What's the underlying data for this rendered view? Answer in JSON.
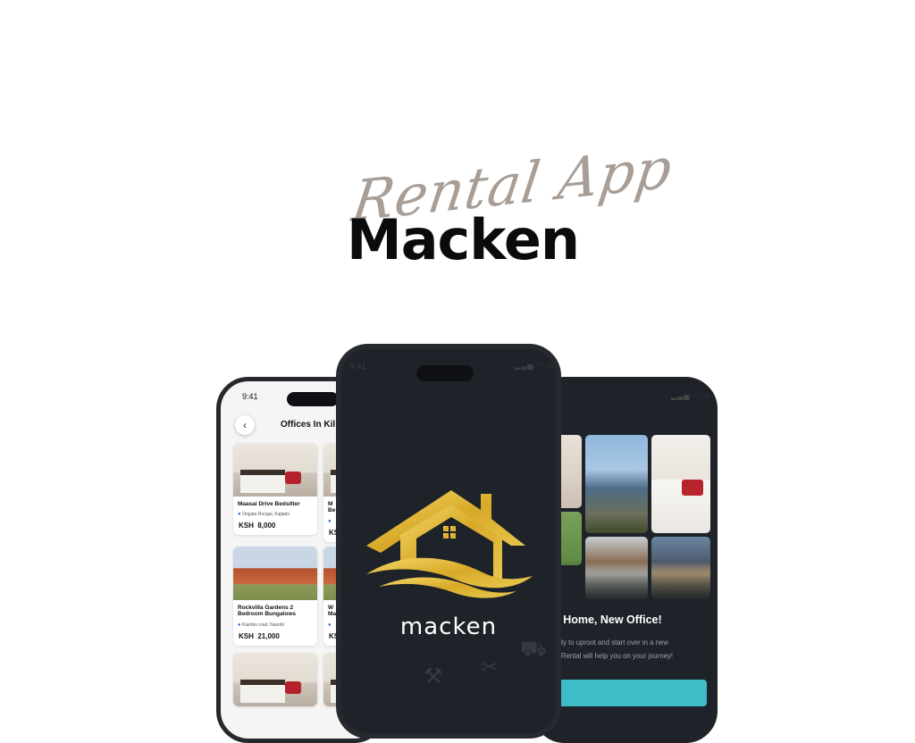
{
  "header": {
    "script_title": "Rental App",
    "main_title": "Macken"
  },
  "left_phone": {
    "status_time": "9:41",
    "heading": "Offices In Kil",
    "listings": [
      {
        "title": "Maasai Drive Bedsitter",
        "location": "Ongata Rongai, Kajiado",
        "currency": "KSH",
        "price": "8,000"
      },
      {
        "title": "Rockvilla Gardens 2 Bedroom Bungalows",
        "location": "Kiambu road, Nairobi",
        "currency": "KSH",
        "price": "21,000"
      }
    ],
    "partial_listings": [
      {
        "title": "M",
        "title2": "Be",
        "price": "KS"
      },
      {
        "title": "W",
        "title2": "Ma",
        "price": "KS"
      }
    ]
  },
  "center_phone": {
    "status_time": "9:41",
    "logo_text": "macken",
    "colors": {
      "logo_gold": "#e8c14a",
      "background": "#1e2229"
    }
  },
  "right_phone": {
    "heading": "w Home, New Office!",
    "body_line1": "eady to uproot and start over in a new",
    "body_line2": "en Rental will help you on your journey!",
    "colors": {
      "button": "#3fbcc7"
    }
  }
}
